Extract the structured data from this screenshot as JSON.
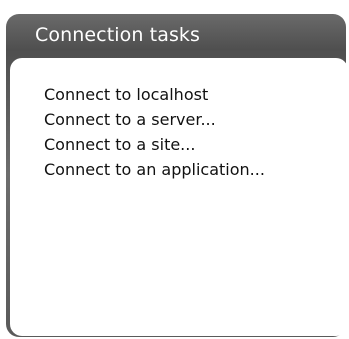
{
  "panel": {
    "title": "Connection tasks",
    "tasks": [
      {
        "label": "Connect to localhost"
      },
      {
        "label": "Connect to a server..."
      },
      {
        "label": "Connect to a site..."
      },
      {
        "label": "Connect to an application..."
      }
    ]
  },
  "colors": {
    "header_background": "#555555",
    "header_text": "#ffffff",
    "body_background": "#ffffff",
    "link_text": "#111111"
  }
}
